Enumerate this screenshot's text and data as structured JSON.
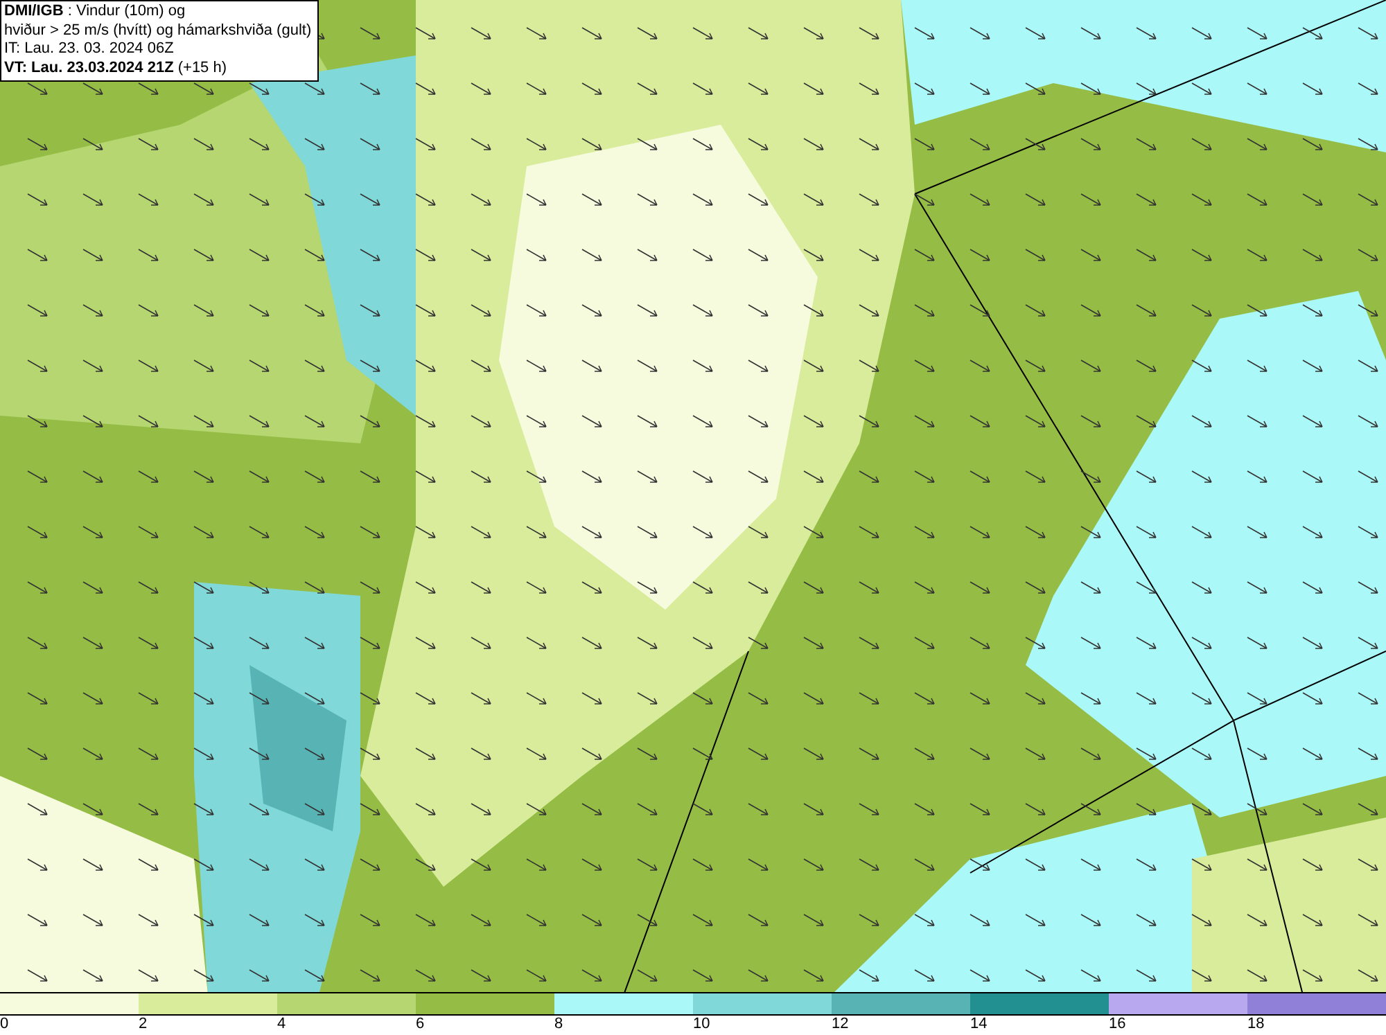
{
  "header": {
    "lines": [
      "**DMI/IGB** : Vindur (10m) og",
      "hviður > 25 m/s (hvítt) og hámarkshviða (gult)",
      "IT: Lau. 23. 03. 2024 06Z",
      "**VT: Lau. 23.03.2024 21Z** (+15 h)"
    ]
  },
  "legend": {
    "segments": [
      {
        "color": "#f5fbdc",
        "label": "0"
      },
      {
        "color": "#d8ec9c",
        "label": "2"
      },
      {
        "color": "#b5d670",
        "label": "4"
      },
      {
        "color": "#95bd45",
        "label": "6"
      },
      {
        "color": "#aaf8f8",
        "label": "8"
      },
      {
        "color": "#80d8d8",
        "label": "10"
      },
      {
        "color": "#58b4b4",
        "label": "12"
      },
      {
        "color": "#229090",
        "label": "14"
      },
      {
        "color": "#b8a8f0",
        "label": "16"
      },
      {
        "color": "#9080d8",
        "label": "18"
      }
    ]
  }
}
